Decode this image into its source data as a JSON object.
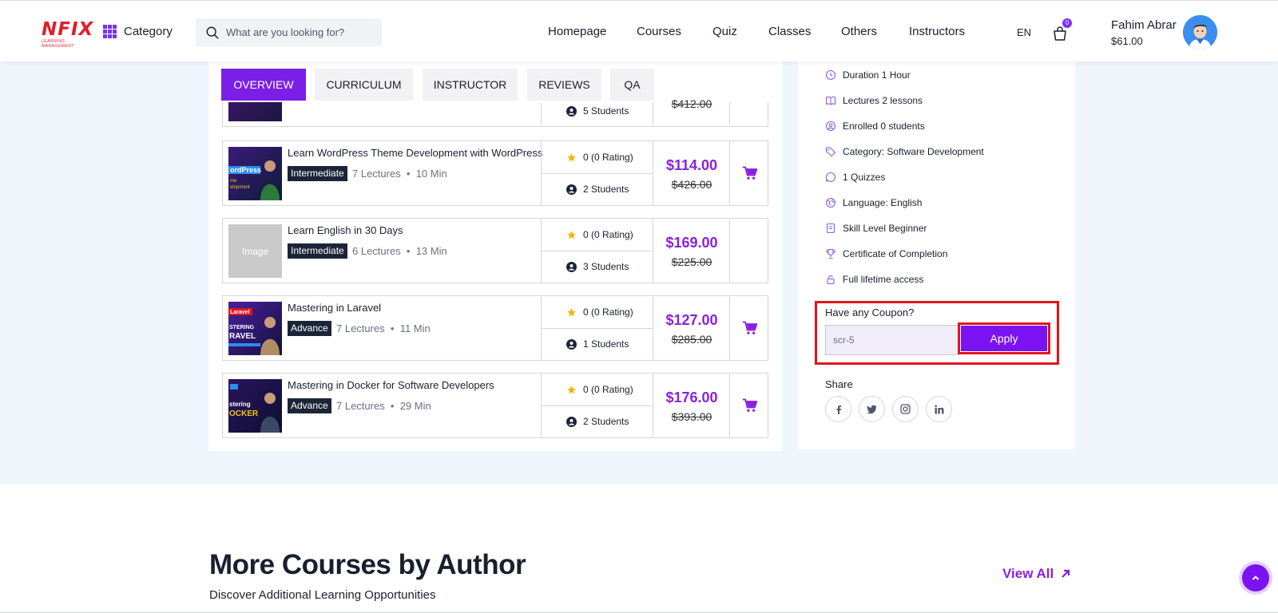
{
  "header": {
    "logo_text": "NFIX",
    "logo_subtext": "LEARNING MANAGEMENT",
    "category_label": "Category",
    "search_placeholder": "What are you looking for?",
    "nav": [
      "Homepage",
      "Courses",
      "Quiz",
      "Classes",
      "Others",
      "Instructors"
    ],
    "language": "EN",
    "cart_count": "0",
    "user_name": "Fahim Abrar",
    "user_balance": "$61.00"
  },
  "tabs": [
    "OVERVIEW",
    "CURRICULUM",
    "INSTRUCTOR",
    "REVIEWS",
    "QA"
  ],
  "partial_row": {
    "students": "5 Students",
    "old_price": "$412.00"
  },
  "courses": [
    {
      "title": "Learn WordPress Theme Development with WordPress",
      "level": "Intermediate",
      "lectures": "7 Lectures",
      "duration": "10 Min",
      "rating": "0 (0 Rating)",
      "students": "2 Students",
      "price": "$114.00",
      "old_price": "$426.00",
      "thumb_text": "ordPress",
      "thumb_text2": "me",
      "thumb_text3": "elopment"
    },
    {
      "title": "Learn English in 30 Days",
      "level": "Intermediate",
      "lectures": "6 Lectures",
      "duration": "13 Min",
      "rating": "0 (0 Rating)",
      "students": "3 Students",
      "price": "$169.00",
      "old_price": "$225.00",
      "thumb_text": "Image"
    },
    {
      "title": "Mastering in Laravel",
      "level": "Advance",
      "lectures": "7 Lectures",
      "duration": "11 Min",
      "rating": "0 (0 Rating)",
      "students": "1 Students",
      "price": "$127.00",
      "old_price": "$285.00",
      "thumb_text": "Laravel",
      "thumb_text2": "STERING",
      "thumb_text3": "RAVEL"
    },
    {
      "title": "Mastering in Docker for Software Developers",
      "level": "Advance",
      "lectures": "7 Lectures",
      "duration": "29 Min",
      "rating": "0 (0 Rating)",
      "students": "2 Students",
      "price": "$176.00",
      "old_price": "$393.00",
      "thumb_text": "stering",
      "thumb_text2": "OCKER"
    }
  ],
  "features": [
    "Duration 1 Hour",
    "Lectures 2 lessons",
    "Enrolled 0 students",
    "Category: Software Development",
    "1 Quizzes",
    "Language: English",
    "Skill Level Beginner",
    "Certificate of Completion",
    "Full lifetime access"
  ],
  "coupon": {
    "title": "Have any Coupon?",
    "value": "scr-5",
    "apply_label": "Apply"
  },
  "share": {
    "title": "Share",
    "icons": [
      "facebook-icon",
      "twitter-icon",
      "instagram-icon",
      "linkedin-icon"
    ]
  },
  "more": {
    "title": "More Courses by Author",
    "subtitle": "Discover Additional Learning Opportunities",
    "view_all": "View All"
  },
  "colors": {
    "accent": "#7b12f2",
    "price": "#8a1fe0",
    "highlight": "#e4131c",
    "band": "#eef6fc"
  }
}
